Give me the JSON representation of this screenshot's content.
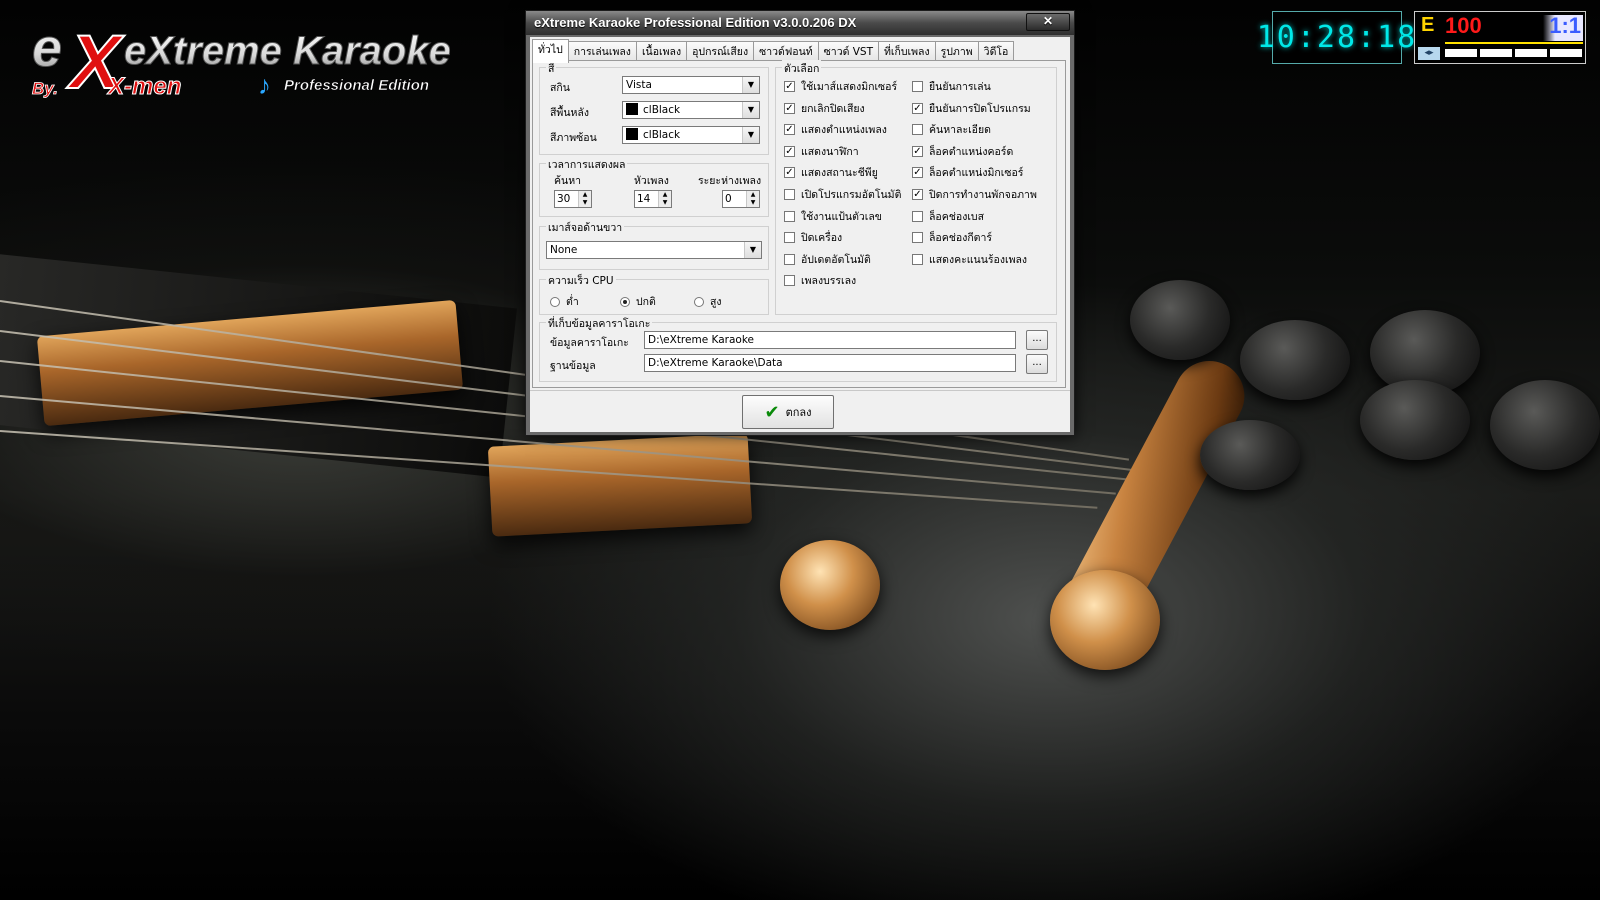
{
  "logo": {
    "main": "eXtreme Karaoke",
    "by": "By.",
    "brand": "X-men",
    "edition": "Professional Edition"
  },
  "clock": {
    "time": "10:28:18"
  },
  "status": {
    "mode": "E",
    "volume": "100",
    "ratio": "1:1"
  },
  "dialog": {
    "title": "eXtreme Karaoke Professional Edition v3.0.0.206 DX",
    "close_label": "✕",
    "tabs": [
      {
        "label": "ทั่วไป",
        "active": true
      },
      {
        "label": "การเล่นเพลง"
      },
      {
        "label": "เนื้อเพลง"
      },
      {
        "label": "อุปกรณ์เสียง"
      },
      {
        "label": "ซาวด์ฟอนท์"
      },
      {
        "label": "ซาวด์ VST"
      },
      {
        "label": "ที่เก็บเพลง"
      },
      {
        "label": "รูปภาพ"
      },
      {
        "label": "วิดีโอ"
      }
    ],
    "color_group": {
      "title": "สี",
      "skin_label": "สกิน",
      "skin_value": "Vista",
      "bg_label": "สีพื้นหลัง",
      "bg_value": "clBlack",
      "overlay_label": "สีภาพซ้อน",
      "overlay_value": "clBlack"
    },
    "display_time": {
      "title": "เวลาการแสดงผล",
      "search_label": "ค้นหา",
      "search_value": "30",
      "title_label": "หัวเพลง",
      "title_value": "14",
      "gap_label": "ระยะห่างเพลง",
      "gap_value": "0"
    },
    "right_mouse": {
      "title": "เมาส์จอด้านขวา",
      "value": "None"
    },
    "cpu": {
      "title": "ความเร็ว CPU",
      "options": [
        {
          "label": "ต่ำ",
          "selected": false
        },
        {
          "label": "ปกติ",
          "selected": true
        },
        {
          "label": "สูง",
          "selected": false
        }
      ]
    },
    "options": {
      "title": "ตัวเลือก",
      "left": [
        {
          "label": "ใช้เมาส์แสดงมิกเซอร์",
          "checked": true
        },
        {
          "label": "ยกเลิกปิดเสียง",
          "checked": true
        },
        {
          "label": "แสดงตำแหน่งเพลง",
          "checked": true
        },
        {
          "label": "แสดงนาฬิกา",
          "checked": true
        },
        {
          "label": "แสดงสถานะชีพียู",
          "checked": true
        },
        {
          "label": "เปิดโปรแกรมอัตโนมัติ",
          "checked": false
        },
        {
          "label": "ใช้งานแป้นตัวเลข",
          "checked": false
        },
        {
          "label": "ปิดเครื่อง",
          "checked": false
        },
        {
          "label": "อัปเดตอัตโนมัติ",
          "checked": false
        },
        {
          "label": "เพลงบรรเลง",
          "checked": false
        }
      ],
      "right": [
        {
          "label": "ยืนยันการเล่น",
          "checked": false
        },
        {
          "label": "ยืนยันการปิดโปรแกรม",
          "checked": true
        },
        {
          "label": "ค้นหาละเอียด",
          "checked": false
        },
        {
          "label": "ล็อคตำแหน่งคอร์ด",
          "checked": true
        },
        {
          "label": "ล็อคตำแหน่งมิกเซอร์",
          "checked": true
        },
        {
          "label": "ปิดการทำงานพักจอภาพ",
          "checked": true
        },
        {
          "label": "ล็อคช่องเบส",
          "checked": false
        },
        {
          "label": "ล็อคช่องกีตาร์",
          "checked": false
        },
        {
          "label": "แสดงคะแนนร้องเพลง",
          "checked": false
        }
      ]
    },
    "storage": {
      "title": "ที่เก็บข้อมูลคาราโอเกะ",
      "karaoke_label": "ข้อมูลคาราโอเกะ",
      "karaoke_path": "D:\\eXtreme Karaoke",
      "db_label": "ฐานข้อมูล",
      "db_path": "D:\\eXtreme Karaoke\\Data",
      "browse_label": "..."
    },
    "ok_label": "ตกลง"
  }
}
